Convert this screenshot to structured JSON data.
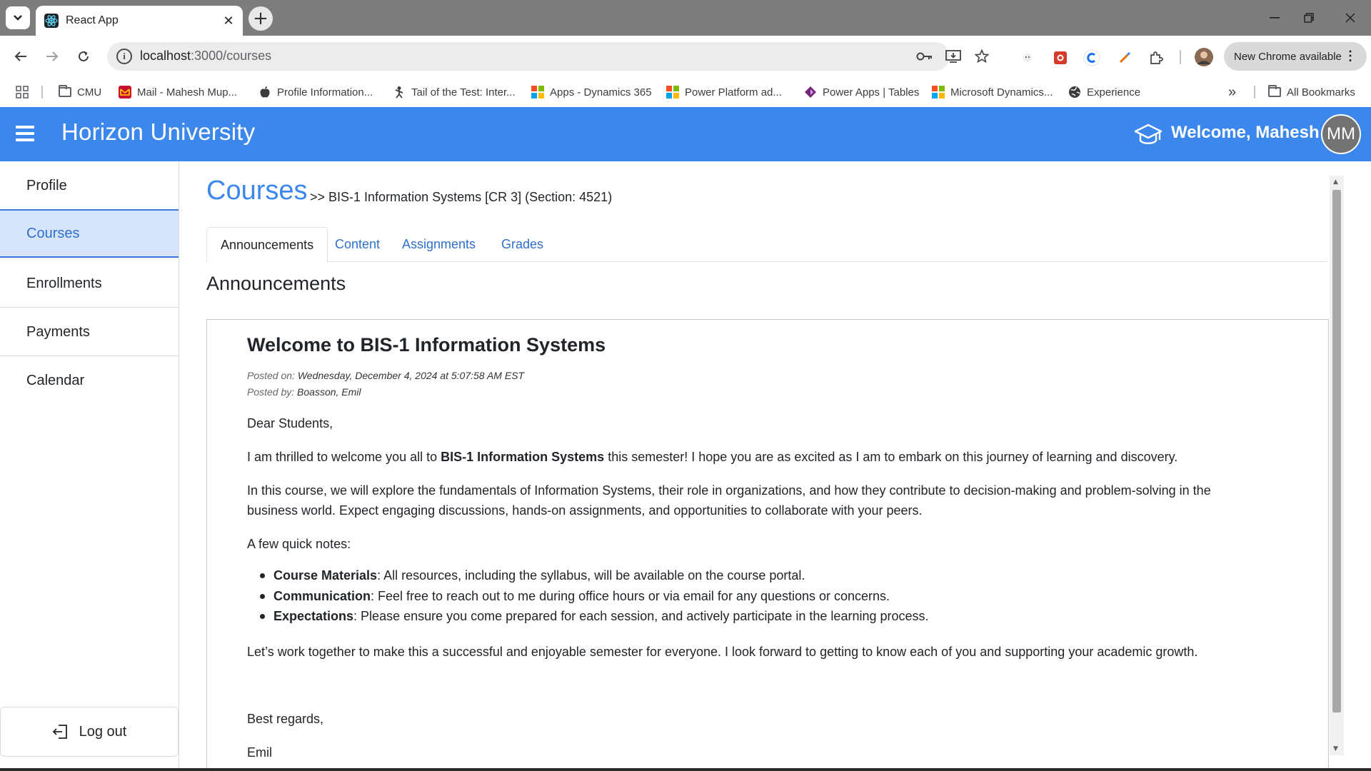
{
  "browser": {
    "tab_title": "React App",
    "tab_close": "✕",
    "new_tab": "+",
    "url_host": "localhost",
    "url_path": ":3000/courses",
    "update_label": "New Chrome available",
    "bookmarks": [
      {
        "label": "CMU",
        "icon": "folder-icon"
      },
      {
        "label": "Mail - Mahesh Mup...",
        "icon": "mail-icon"
      },
      {
        "label": "Profile Information...",
        "icon": "apple-icon"
      },
      {
        "label": "Tail of the Test: Inter...",
        "icon": "person-icon"
      },
      {
        "label": "Apps - Dynamics 365",
        "icon": "microsoft-icon"
      },
      {
        "label": "Power Platform ad...",
        "icon": "microsoft-icon"
      },
      {
        "label": "Power Apps | Tables",
        "icon": "power-apps-icon"
      },
      {
        "label": "Microsoft Dynamics...",
        "icon": "microsoft-icon"
      },
      {
        "label": "Experience",
        "icon": "globe-icon"
      }
    ],
    "overflow": "»",
    "all_bookmarks": "All Bookmarks"
  },
  "app": {
    "brand": "Horizon University",
    "welcome": "Welcome, Mahesh",
    "avatar_initials": "MM",
    "accent_color": "#3b87ec"
  },
  "sidebar": {
    "items": [
      {
        "label": "Profile"
      },
      {
        "label": "Courses"
      },
      {
        "label": "Enrollments"
      },
      {
        "label": "Payments"
      },
      {
        "label": "Calendar"
      }
    ],
    "active": "Courses",
    "logout": "Log out"
  },
  "main": {
    "title": "Courses",
    "breadcrumb": ">> BIS-1 Information Systems [CR 3] (Section: 4521)",
    "tabs": [
      {
        "label": "Announcements"
      },
      {
        "label": "Content"
      },
      {
        "label": "Assignments"
      },
      {
        "label": "Grades"
      }
    ],
    "active_tab": "Announcements",
    "section_heading": "Announcements",
    "announcement": {
      "title": "Welcome to BIS-1 Information Systems",
      "posted_on_label": "Posted on: ",
      "posted_on": "Wednesday, December 4, 2024 at 5:07:58 AM EST",
      "posted_by_label": "Posted by: ",
      "posted_by": "Boasson, Emil",
      "greeting": "Dear Students,",
      "p1_before": "I am thrilled to welcome you all to ",
      "p1_bold": "BIS-1 Information Systems",
      "p1_after": " this semester! I hope you are as excited as I am to embark on this journey of learning and discovery.",
      "p2": "In this course, we will explore the fundamentals of Information Systems, their role in organizations, and how they contribute to decision-making and problem-solving in the business world. Expect engaging discussions, hands-on assignments, and opportunities to collaborate with your peers.",
      "notes_intro": "A few quick notes:",
      "notes": [
        {
          "bold": "Course Materials",
          "text": ": All resources, including the syllabus, will be available on the course portal."
        },
        {
          "bold": "Communication",
          "text": ": Feel free to reach out to me during office hours or via email for any questions or concerns."
        },
        {
          "bold": "Expectations",
          "text": ": Please ensure you come prepared for each session, and actively participate in the learning process."
        }
      ],
      "closing": "Let’s work together to make this a successful and enjoyable semester for everyone. I look forward to getting to know each of you and supporting your academic growth.",
      "signoff": "Best regards,",
      "signature": "Emil"
    }
  }
}
